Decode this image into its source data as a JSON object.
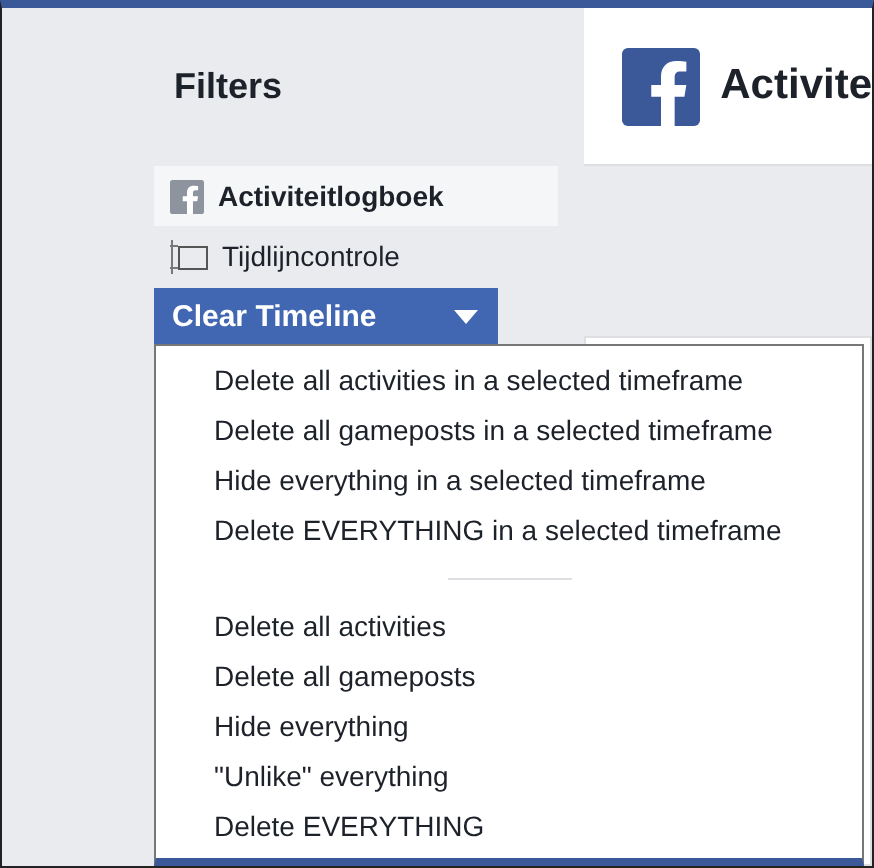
{
  "sidebar": {
    "title": "Filters",
    "items": [
      {
        "label": "Activiteitlogboek",
        "kind": "facebook",
        "selected": true
      },
      {
        "label": "Tijdlijncontrole",
        "kind": "timeline",
        "selected": false
      }
    ]
  },
  "header": {
    "title": "Activite"
  },
  "clear_button": {
    "label": "Clear Timeline",
    "expanded": true
  },
  "menu": {
    "groups": [
      [
        "Delete all activities in a selected timeframe",
        "Delete all gameposts in a selected timeframe",
        "Hide everything in a selected timeframe",
        "Delete EVERYTHING in a selected timeframe"
      ],
      [
        "Delete all activities",
        "Delete all gameposts",
        "Hide everything",
        "\"Unlike\" everything",
        "Delete EVERYTHING"
      ]
    ]
  }
}
